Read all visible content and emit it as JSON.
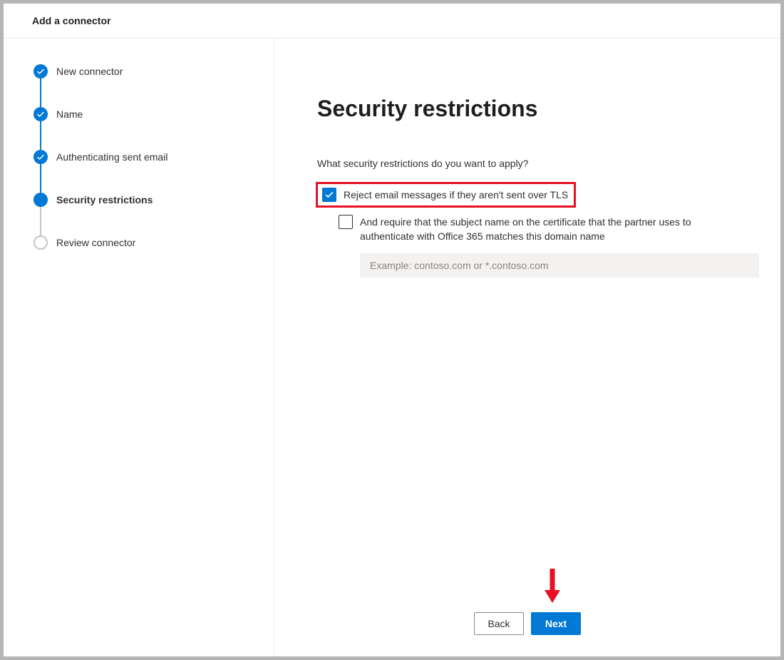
{
  "header": {
    "title": "Add a connector"
  },
  "sidebar": {
    "steps": [
      {
        "label": "New connector"
      },
      {
        "label": "Name"
      },
      {
        "label": "Authenticating sent email"
      },
      {
        "label": "Security restrictions"
      },
      {
        "label": "Review connector"
      }
    ]
  },
  "main": {
    "heading": "Security restrictions",
    "prompt": "What security restrictions do you want to apply?",
    "option_tls_label": "Reject email messages if they aren't sent over TLS",
    "option_cert_label": "And require that the subject name on the certificate that the partner uses to authenticate with Office 365 matches this domain name",
    "domain_placeholder": "Example: contoso.com or *.contoso.com",
    "domain_value": ""
  },
  "footer": {
    "back_label": "Back",
    "next_label": "Next"
  }
}
